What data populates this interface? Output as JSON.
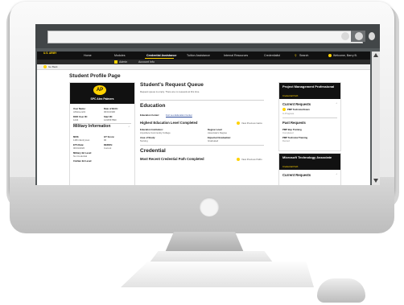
{
  "site": {
    "logo": "U.S. ARMY",
    "nav": [
      "Home",
      "Modules",
      "Credential Assistance",
      "Tuition Assistance",
      "Internal Resources",
      "Credentialist",
      "Search"
    ],
    "welcome": "Welcome, Barry B.",
    "subnav": [
      "Admin",
      "Account Info"
    ],
    "breadcrumb": "Go Back",
    "page_title": "Student Profile Page"
  },
  "profile": {
    "badge": "AP",
    "rank_name": "SPC Alex Palmers",
    "fields": [
      {
        "label": "User Name:",
        "value": "APalmers01"
      },
      {
        "label": "Date of Birth:",
        "value": "06/01/1990"
      },
      {
        "label": "DOD User ID:",
        "value": "1234"
      },
      {
        "label": "Start ID:",
        "value": "1234567890"
      }
    ],
    "military_heading": "Military Information",
    "military_fields": [
      {
        "label": "MOS:",
        "value": "11B Infantryman"
      },
      {
        "label": "GT Score:",
        "value": "96"
      },
      {
        "label": "ETS Date:",
        "value": "06/01/2026"
      },
      {
        "label": "DEROS:",
        "value": "Current"
      },
      {
        "label": "Military Ed Level:",
        "value": "No Credential"
      },
      {
        "label": "Civilian Ed Level:",
        "value": ""
      }
    ]
  },
  "queue": {
    "title": "Student's Request Queue",
    "empty_text": "Request queue is empty. There are no requests at this time."
  },
  "education": {
    "title": "Education",
    "center_label": "Education Center:",
    "center_value": "Fort Leo Education Center",
    "highest_label": "Highest Education Level Completed",
    "action": "View Previous Gains",
    "fields": [
      {
        "label": "Education Institution:",
        "value": "Anywhere Community College"
      },
      {
        "label": "Degree Level:",
        "value": "Associate's Degree"
      },
      {
        "label": "Area of Study:",
        "value": "Nursing"
      },
      {
        "label": "Expected Graduation:",
        "value": "Graduated"
      }
    ]
  },
  "credential": {
    "title": "Credential",
    "sub": "Most Recent Credential Path Completed",
    "action": "View Previous Paths"
  },
  "panels": [
    {
      "title": "Project Management Professional",
      "sub": "Credential Path",
      "current_label": "Current Requests",
      "current_item": "PMP Technical Exam",
      "current_status": "In Progress",
      "past_label": "Past Requests",
      "past_items": [
        {
          "name": "PMP Bcp Training",
          "status": "Completed"
        },
        {
          "name": "PMP Technical Training",
          "status": "Denied"
        }
      ]
    },
    {
      "title": "Microsoft Technology Associate",
      "sub": "Credential Path",
      "current_label": "Current Requests"
    }
  ]
}
